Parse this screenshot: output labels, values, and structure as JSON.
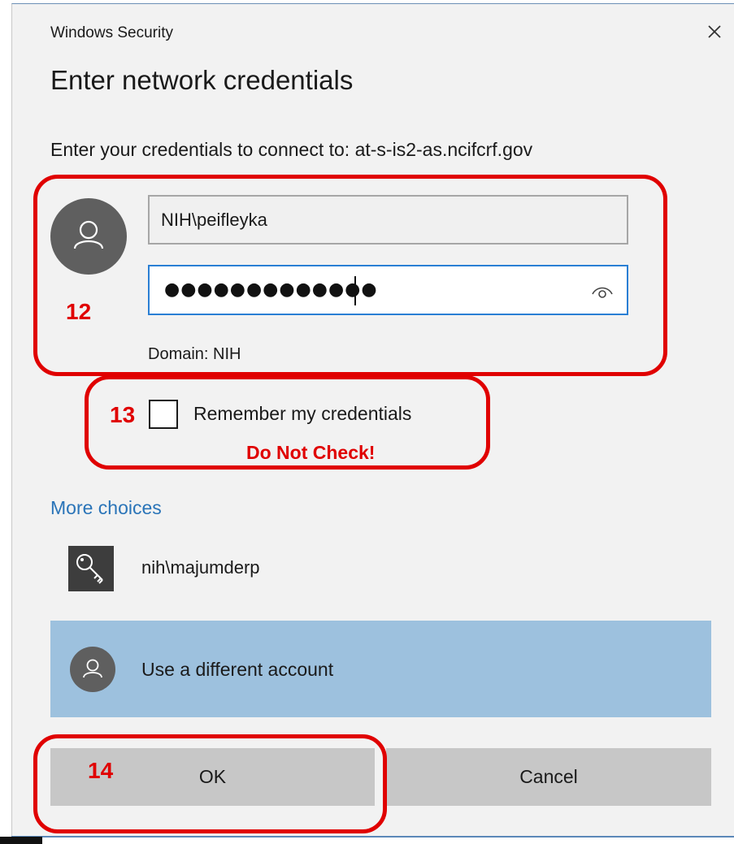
{
  "window": {
    "title": "Windows Security",
    "close_icon": "close-icon"
  },
  "dialog": {
    "heading": "Enter network credentials",
    "subtext": "Enter your credentials to connect to: at-s-is2-as.ncifcrf.gov"
  },
  "form": {
    "username_value": "NIH\\peifleyka",
    "password_masked": "●●●●●●●●●●●●●",
    "reveal_icon": "eye-icon",
    "domain_text": "Domain: NIH",
    "remember_label": "Remember my credentials",
    "remember_checked": false
  },
  "choices": {
    "more_choices_label": "More choices",
    "saved_credential": "nih\\majumderp",
    "saved_credential_icon": "key-icon",
    "different_account_label": "Use a different account",
    "different_account_selected": true
  },
  "buttons": {
    "ok_label": "OK",
    "cancel_label": "Cancel"
  },
  "annotations": {
    "step_12": "12",
    "step_13": "13",
    "step_14": "14",
    "warning": "Do Not Check!",
    "color": "#e00000"
  },
  "colors": {
    "accent_link": "#2a74b8",
    "selected_row": "#9dc1de",
    "focus_border": "#2a7fd4",
    "button_bg": "#c7c7c7"
  }
}
